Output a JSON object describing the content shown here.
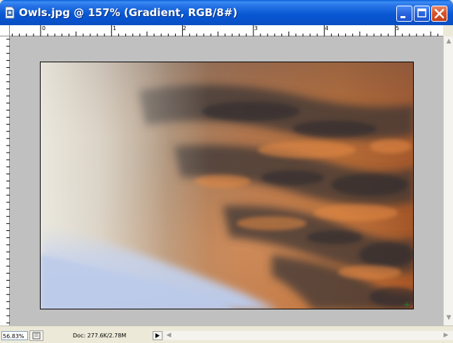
{
  "window": {
    "title": "Owls.jpg @ 157% (Gradient, RGB/8#)",
    "icon": "photoshop-document-icon",
    "buttons": {
      "minimize": "minimize-icon",
      "maximize": "maximize-icon",
      "close": "close-icon"
    }
  },
  "ruler": {
    "top_labels": [
      "0",
      "1",
      "2",
      "3",
      "4",
      "5"
    ]
  },
  "statusbar": {
    "zoom": "56.83%",
    "doc_info": "Doc: 277.6K/2.78M"
  },
  "colors": {
    "titlebar_blue": "#0a58d4",
    "canvas_gray": "#c0c0c0",
    "sky_orange": "#c56d2e",
    "sky_pale": "#e9e6dc",
    "sky_blue": "#c3d0ea"
  }
}
